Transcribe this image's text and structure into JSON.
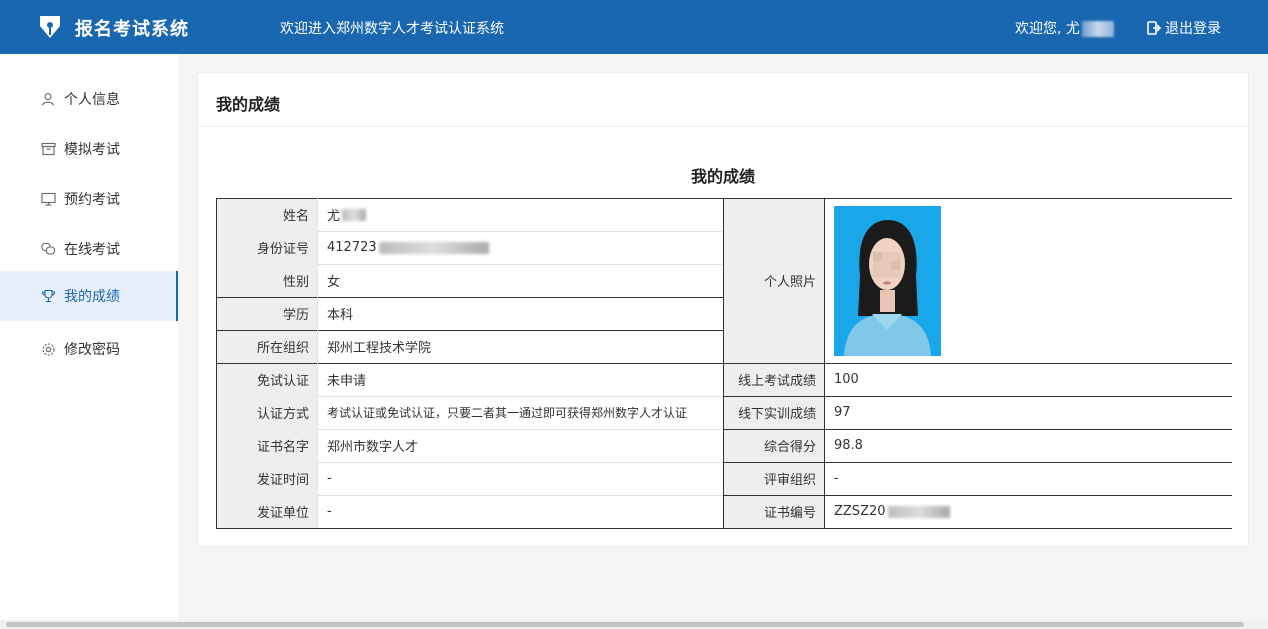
{
  "header": {
    "app_title": "报名考试系统",
    "welcome": "欢迎进入郑州数字人才考试认证系统",
    "greeting": "欢迎您, 尤",
    "logout": "退出登录"
  },
  "sidebar": {
    "items": [
      {
        "label": "个人信息",
        "icon": "user-icon"
      },
      {
        "label": "模拟考试",
        "icon": "archive-icon"
      },
      {
        "label": "预约考试",
        "icon": "monitor-icon"
      },
      {
        "label": "在线考试",
        "icon": "chat-icon"
      },
      {
        "label": "我的成绩",
        "icon": "trophy-icon",
        "active": true
      },
      {
        "label": "修改密码",
        "icon": "gear-icon"
      }
    ]
  },
  "main": {
    "card_title": "我的成绩",
    "table_title": "我的成绩",
    "left_rows": [
      {
        "label": "姓名",
        "value": "尤"
      },
      {
        "label": "身份证号",
        "value": "412723"
      },
      {
        "label": "性别",
        "value": "女"
      },
      {
        "label": "学历",
        "value": "本科"
      },
      {
        "label": "所在组织",
        "value": "郑州工程技术学院"
      },
      {
        "label": "免试认证",
        "value": "未申请"
      },
      {
        "label": "认证方式",
        "value": "考试认证或免试认证，只要二者其一通过即可获得郑州数字人才认证"
      },
      {
        "label": "证书名字",
        "value": "郑州市数字人才"
      },
      {
        "label": "发证时间",
        "value": "-"
      },
      {
        "label": "发证单位",
        "value": "-"
      }
    ],
    "photo_label": "个人照片",
    "right_rows": [
      {
        "label": "线上考试成绩",
        "value": "100"
      },
      {
        "label": "线下实训成绩",
        "value": "97"
      },
      {
        "label": "综合得分",
        "value": "98.8"
      },
      {
        "label": "评审组织",
        "value": "-"
      },
      {
        "label": "证书编号",
        "value": "ZZSZ20"
      }
    ]
  },
  "colors": {
    "header": "#1a67b1",
    "accent": "#1a67b1",
    "photo_bg": "#18a6e8"
  }
}
